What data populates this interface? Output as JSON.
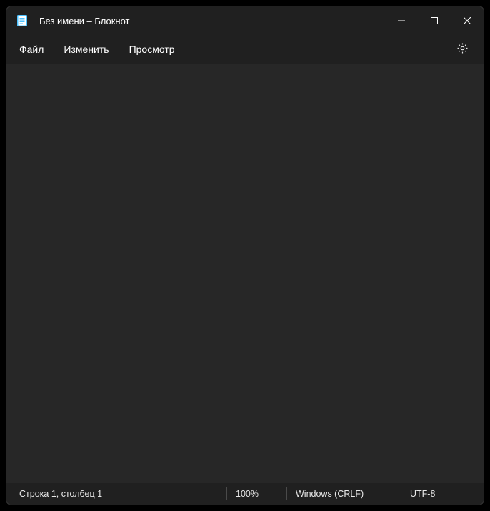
{
  "titlebar": {
    "title": "Без имени – Блокнот"
  },
  "menu": {
    "file": "Файл",
    "edit": "Изменить",
    "view": "Просмотр"
  },
  "editor": {
    "content": ""
  },
  "statusbar": {
    "position": "Строка 1, столбец 1",
    "zoom": "100%",
    "line_ending": "Windows (CRLF)",
    "encoding": "UTF-8"
  }
}
